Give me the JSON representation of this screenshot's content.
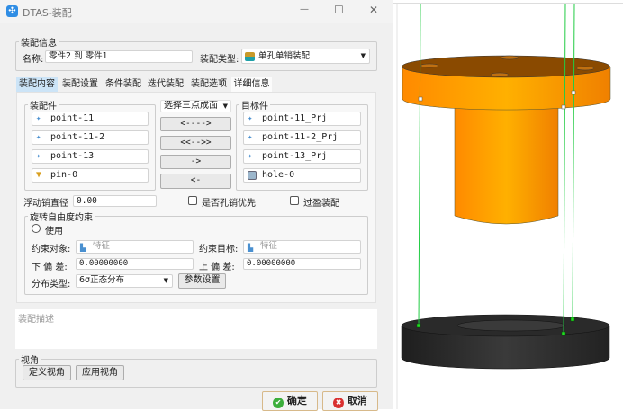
{
  "window": {
    "title": "DTAS-装配",
    "minimize": "—",
    "maximize": "☐",
    "close": "✕"
  },
  "info": {
    "group": "装配信息",
    "name_label": "名称:",
    "name_value": "零件2 到 零件1",
    "type_label": "装配类型:",
    "type_value": "单孔单销装配"
  },
  "tabs": [
    {
      "label": "装配内容",
      "active": true
    },
    {
      "label": "装配设置"
    },
    {
      "label": "条件装配"
    },
    {
      "label": "迭代装配"
    },
    {
      "label": "装配选项"
    },
    {
      "label": "详细信息"
    }
  ],
  "parts": {
    "group": "装配件",
    "items": [
      {
        "label": "point-11",
        "icon": "point-icon"
      },
      {
        "label": "point-11-2",
        "icon": "point-icon"
      },
      {
        "label": "point-13",
        "icon": "point-icon"
      },
      {
        "label": "pin-0",
        "icon": "pin-icon"
      }
    ]
  },
  "middle": {
    "mode": "选择三点成面",
    "buttons": [
      "<---->",
      "<<-->>",
      "->",
      "<-"
    ]
  },
  "targets": {
    "group": "目标件",
    "items": [
      {
        "label": "point-11_Prj",
        "icon": "point-icon"
      },
      {
        "label": "point-11-2_Prj",
        "icon": "point-icon"
      },
      {
        "label": "point-13_Prj",
        "icon": "point-icon"
      },
      {
        "label": "hole-0",
        "icon": "hole-icon"
      }
    ]
  },
  "float_pin": {
    "label": "浮动销直径",
    "value": "0.00"
  },
  "options": {
    "hole_first": "是否孔销优先",
    "hole_first_checked": false,
    "interference": "过盈装配",
    "interference_checked": false
  },
  "rotation": {
    "group": "旋转自由度约束",
    "use_label": "使用",
    "use_checked": false,
    "obj_label": "约束对象:",
    "obj_placeholder": "特征",
    "target_label": "约束目标:",
    "target_placeholder": "特征",
    "lower_label": "下 偏 差:",
    "lower_value": "0.00000000",
    "upper_label": "上 偏 差:",
    "upper_value": "0.00000000",
    "dist_label": "分布类型:",
    "dist_value": "6σ正态分布",
    "param_button": "参数设置"
  },
  "description": {
    "placeholder": "装配描述"
  },
  "view": {
    "group": "视角",
    "define": "定义视角",
    "apply": "应用视角"
  },
  "footer": {
    "ok": "确定",
    "cancel": "取消"
  },
  "colors": {
    "part_top": "#ff9900",
    "part_bottom": "#2b2b2b",
    "guide_line": "#22cc44",
    "tab_active": "#cce4f7"
  }
}
